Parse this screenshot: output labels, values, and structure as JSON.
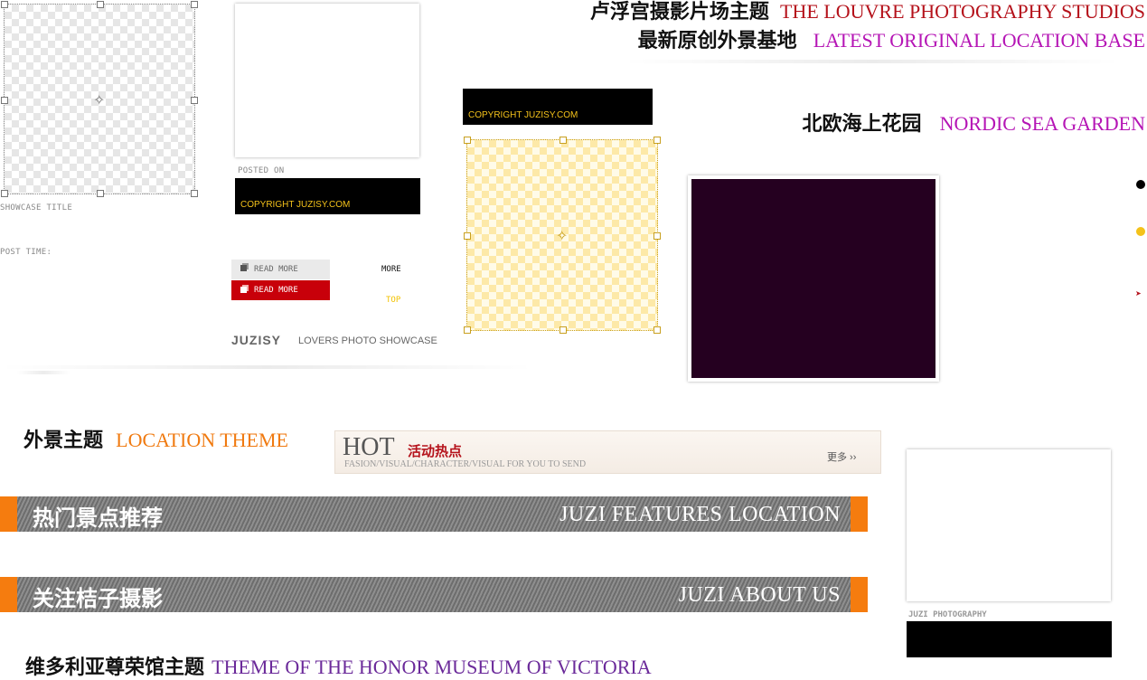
{
  "showcase": {
    "title": "SHOWCASE TITLE",
    "post_time": "POST TIME:"
  },
  "post": {
    "posted_on": "POSTED ON",
    "copyright": "COPYRIGHT JUZISY.COM"
  },
  "buttons": {
    "read_more_1": "READ MORE",
    "read_more_2": "READ MORE",
    "more": "MORE",
    "top": "TOP"
  },
  "brand": {
    "name": "JUZISY",
    "tagline": "LOVERS PHOTO SHOWCASE"
  },
  "headings": {
    "louvre_cn": "卢浮宫摄影片场主题",
    "louvre_en": "THE LOUVRE PHOTOGRAPHY STUDIOS",
    "latest_cn": "最新原创外景基地",
    "latest_en": "LATEST ORIGINAL LOCATION BASE",
    "nordic_cn": "北欧海上花园",
    "nordic_en": "NORDIC SEA GARDEN",
    "location_cn": "外景主题",
    "location_en": "LOCATION THEME",
    "victoria_cn": "维多利亚尊荣馆主题",
    "victoria_en": "THEME OF THE HONOR MUSEUM OF VICTORIA"
  },
  "hot_bar": {
    "hot": "HOT",
    "hot_cn": "活动热点",
    "subtitle": "FASION/VISUAL/CHARACTER/VISUAL FOR YOU TO SEND",
    "more": "更多 ››"
  },
  "banners": {
    "features_cn": "热门景点推荐",
    "features_en": "JUZI FEATURES LOCATION",
    "about_cn": "关注桔子摄影",
    "about_en": "JUZI ABOUT US"
  },
  "photography_label": "JUZI PHOTOGRAPHY",
  "colors": {
    "red_en": "#b5121b",
    "magenta_en": "#b515b5",
    "orange_en": "#f07a10",
    "purple_en": "#6b2a9a",
    "orange_bar": "#f57c0f",
    "read_more_red": "#c8000a",
    "copyright_yellow": "#f4c21a",
    "dark_panel": "#250020"
  }
}
